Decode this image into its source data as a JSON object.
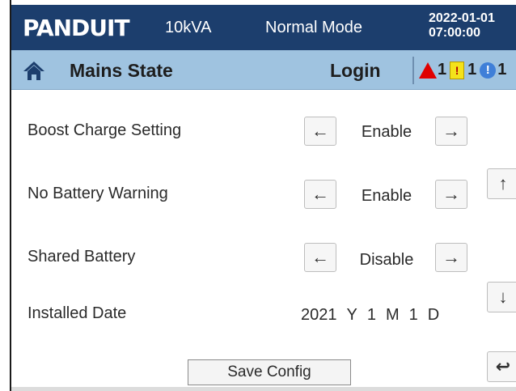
{
  "header": {
    "logo": "PANDUIT",
    "capacity": "10kVA",
    "mode": "Normal Mode",
    "date": "2022-01-01",
    "time": "07:00:00"
  },
  "subheader": {
    "title": "Mains State",
    "login": "Login",
    "alarms": [
      {
        "type": "alarm-triangle",
        "count": "1",
        "color": "#e00000"
      },
      {
        "type": "warning",
        "count": "1",
        "color": "#f4e21a"
      },
      {
        "type": "info",
        "count": "1",
        "color": "#3f7fd8"
      }
    ]
  },
  "settings": {
    "boost_charge": {
      "label": "Boost Charge Setting",
      "value": "Enable"
    },
    "no_battery_warning": {
      "label": "No Battery Warning",
      "value": "Enable"
    },
    "shared_battery": {
      "label": "Shared Battery",
      "value": "Disable"
    },
    "installed_date": {
      "label": "Installed Date",
      "year": "2021",
      "year_unit": "Y",
      "month": "1",
      "month_unit": "M",
      "day": "1",
      "day_unit": "D"
    }
  },
  "actions": {
    "save": "Save Config"
  },
  "icons": {
    "left_arrow": "left-arrow-icon",
    "right_arrow": "right-arrow-icon",
    "up_arrow": "up-arrow-icon",
    "down_arrow": "down-arrow-icon",
    "back": "back-icon",
    "home": "home-icon"
  },
  "colors": {
    "header_bg": "#1c3e6d",
    "subheader_bg": "#9fc3e0"
  }
}
